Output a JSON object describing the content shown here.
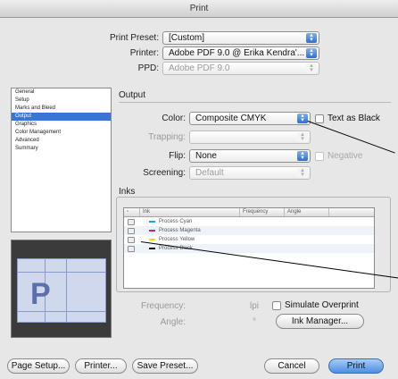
{
  "window": {
    "title": "Print"
  },
  "header": {
    "print_preset": {
      "label": "Print Preset:",
      "value": "[Custom]"
    },
    "printer": {
      "label": "Printer:",
      "value": "Adobe PDF 9.0 @ Erika Kendra'..."
    },
    "ppd": {
      "label": "PPD:",
      "value": "Adobe PDF 9.0"
    }
  },
  "sidebar": {
    "items": [
      "General",
      "Setup",
      "Marks and Bleed",
      "Output",
      "Graphics",
      "Color Management",
      "Advanced",
      "Summary"
    ],
    "selected": "Output"
  },
  "output": {
    "section_title": "Output",
    "color": {
      "label": "Color:",
      "value": "Composite CMYK"
    },
    "text_as_black": {
      "label": "Text as Black",
      "checked": false
    },
    "trapping": {
      "label": "Trapping:",
      "value": ""
    },
    "flip": {
      "label": "Flip:",
      "value": "None"
    },
    "negative": {
      "label": "Negative",
      "checked": false
    },
    "screening": {
      "label": "Screening:",
      "value": "Default"
    }
  },
  "inks": {
    "section_title": "Inks",
    "columns": [
      "Ink",
      "Frequency",
      "Angle"
    ],
    "rows": [
      {
        "name": "Process Cyan",
        "color": "#1aa3e8"
      },
      {
        "name": "Process Magenta",
        "color": "#e0148c"
      },
      {
        "name": "Process Yellow",
        "color": "#f2e10a"
      },
      {
        "name": "Process Black",
        "color": "#111111"
      }
    ],
    "frequency": {
      "label": "Frequency:",
      "unit": "lpi"
    },
    "angle": {
      "label": "Angle:",
      "unit": "°"
    },
    "simulate_overprint": {
      "label": "Simulate Overprint",
      "checked": false
    },
    "ink_manager_label": "Ink Manager..."
  },
  "buttons": {
    "page_setup": "Page Setup...",
    "printer": "Printer...",
    "save_preset": "Save Preset...",
    "cancel": "Cancel",
    "print": "Print"
  }
}
